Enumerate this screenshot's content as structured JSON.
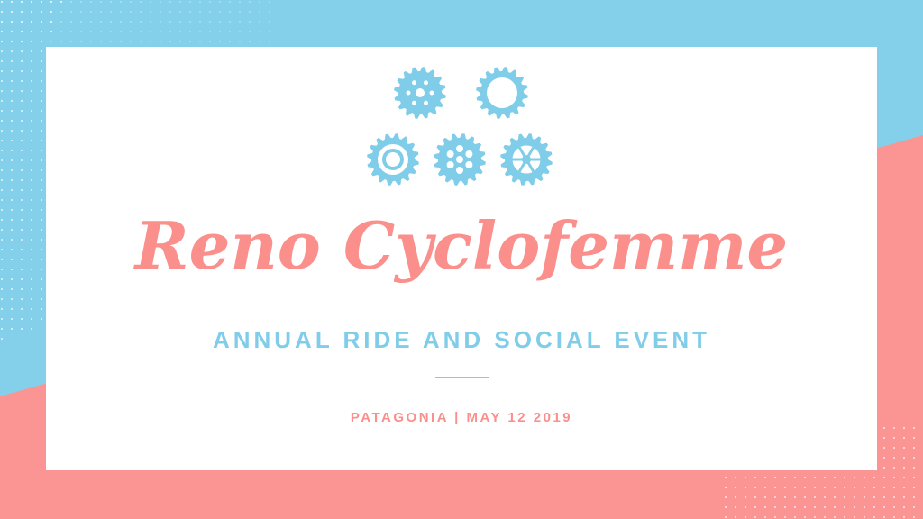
{
  "event": {
    "title": "Reno Cyclofemme",
    "subtitle": "ANNUAL RIDE AND SOCIAL EVENT",
    "details": "PATAGONIA | MAY 12 2019"
  },
  "colors": {
    "blue": "#84d0ea",
    "pink": "#fa9593",
    "title": "#fa8f8c",
    "accent": "#7fcde8",
    "card": "#ffffff"
  },
  "icons": [
    "gear-icon",
    "gear-ring-icon",
    "gear-hub-icon",
    "gear-spoked-icon",
    "gear-wheel-icon"
  ]
}
